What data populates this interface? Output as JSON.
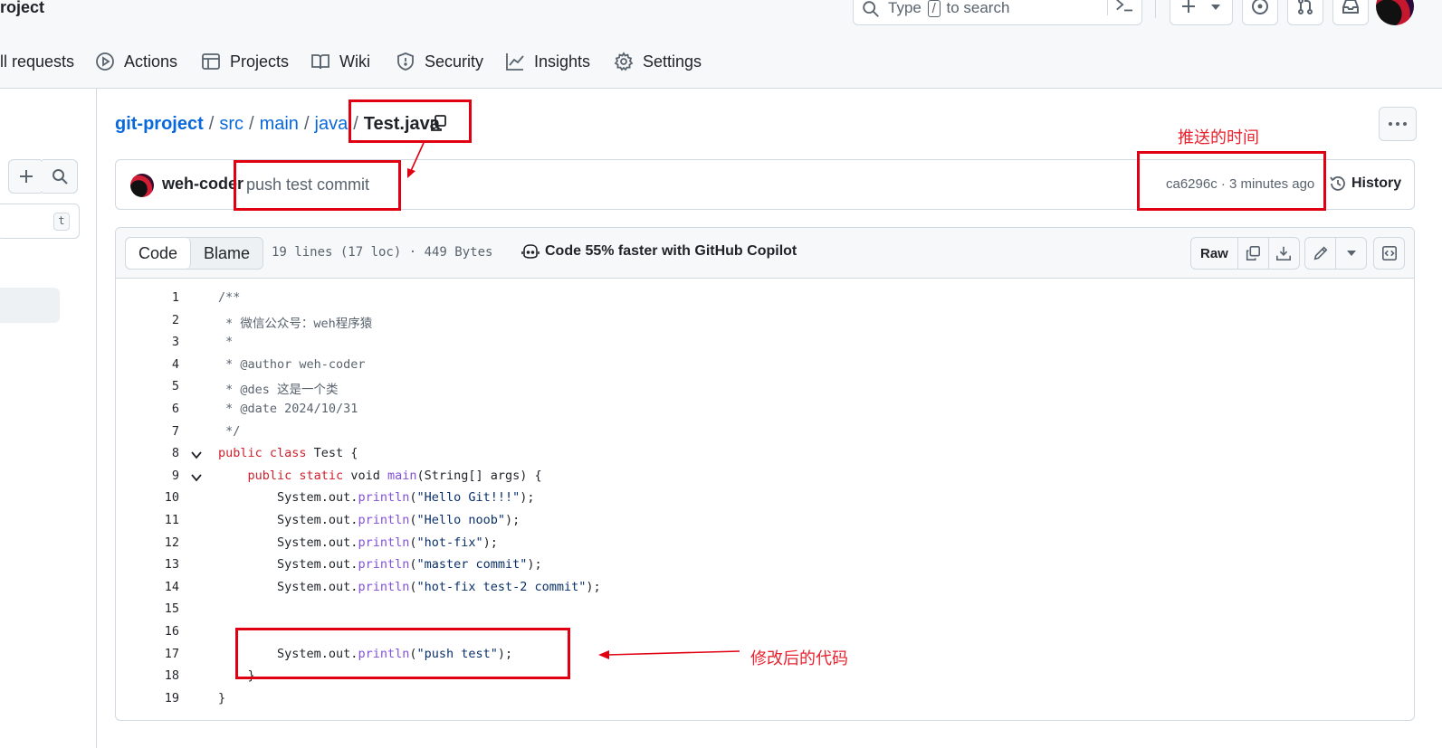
{
  "header": {
    "repo_name": "roject",
    "search_prefix": "Type",
    "search_key": "/",
    "search_suffix": "to search"
  },
  "tabs": [
    {
      "label": "ll requests",
      "icon": "pull-request-icon"
    },
    {
      "label": "Actions",
      "icon": "play-icon"
    },
    {
      "label": "Projects",
      "icon": "table-icon"
    },
    {
      "label": "Wiki",
      "icon": "book-icon"
    },
    {
      "label": "Security",
      "icon": "shield-icon"
    },
    {
      "label": "Insights",
      "icon": "graph-icon"
    },
    {
      "label": "Settings",
      "icon": "gear-icon"
    }
  ],
  "sidebar": {
    "shortcut_key": "t"
  },
  "breadcrumb": {
    "repo": "git-project",
    "parts": [
      "src",
      "main",
      "java"
    ],
    "file": "Test.java",
    "separator": "/"
  },
  "commit": {
    "author": "weh-coder",
    "message": "push test commit",
    "meta": "ca6296c · 3 minutes ago",
    "history_label": "History"
  },
  "file": {
    "tab_code": "Code",
    "tab_blame": "Blame",
    "stats": "19 lines (17 loc) · 449 Bytes",
    "copilot": "Code 55% faster with GitHub Copilot",
    "raw_label": "Raw"
  },
  "code_lines": [
    {
      "n": "1",
      "parts": [
        [
          "cm",
          "/**"
        ]
      ]
    },
    {
      "n": "2",
      "parts": [
        [
          "cm",
          " * 微信公众号：weh程序猿"
        ]
      ]
    },
    {
      "n": "3",
      "parts": [
        [
          "cm",
          " *"
        ]
      ]
    },
    {
      "n": "4",
      "parts": [
        [
          "cm",
          " * @author weh-coder"
        ]
      ]
    },
    {
      "n": "5",
      "parts": [
        [
          "cm",
          " * @des 这是一个类"
        ]
      ]
    },
    {
      "n": "6",
      "parts": [
        [
          "cm",
          " * @date 2024/10/31"
        ]
      ]
    },
    {
      "n": "7",
      "parts": [
        [
          "cm",
          " */"
        ]
      ]
    },
    {
      "n": "8",
      "fold": true,
      "parts": [
        [
          "kw",
          "public class "
        ],
        [
          "",
          "Test {"
        ]
      ]
    },
    {
      "n": "9",
      "fold": true,
      "parts": [
        [
          "",
          "    "
        ],
        [
          "kw",
          "public static "
        ],
        [
          "",
          "void "
        ],
        [
          "fn",
          "main"
        ],
        [
          "",
          "(String[] args) {"
        ]
      ]
    },
    {
      "n": "10",
      "parts": [
        [
          "",
          "        System.out."
        ],
        [
          "fn",
          "println"
        ],
        [
          "",
          "("
        ],
        [
          "st",
          "\"Hello Git!!!\""
        ],
        [
          "",
          ");"
        ]
      ]
    },
    {
      "n": "11",
      "parts": [
        [
          "",
          "        System.out."
        ],
        [
          "fn",
          "println"
        ],
        [
          "",
          "("
        ],
        [
          "st",
          "\"Hello noob\""
        ],
        [
          "",
          ");"
        ]
      ]
    },
    {
      "n": "12",
      "parts": [
        [
          "",
          "        System.out."
        ],
        [
          "fn",
          "println"
        ],
        [
          "",
          "("
        ],
        [
          "st",
          "\"hot-fix\""
        ],
        [
          "",
          ");"
        ]
      ]
    },
    {
      "n": "13",
      "parts": [
        [
          "",
          "        System.out."
        ],
        [
          "fn",
          "println"
        ],
        [
          "",
          "("
        ],
        [
          "st",
          "\"master commit\""
        ],
        [
          "",
          ");"
        ]
      ]
    },
    {
      "n": "14",
      "parts": [
        [
          "",
          "        System.out."
        ],
        [
          "fn",
          "println"
        ],
        [
          "",
          "("
        ],
        [
          "st",
          "\"hot-fix test-2 commit\""
        ],
        [
          "",
          ");"
        ]
      ]
    },
    {
      "n": "15",
      "parts": [
        [
          "",
          ""
        ]
      ]
    },
    {
      "n": "16",
      "parts": [
        [
          "",
          ""
        ]
      ]
    },
    {
      "n": "17",
      "parts": [
        [
          "",
          "        System.out."
        ],
        [
          "fn",
          "println"
        ],
        [
          "",
          "("
        ],
        [
          "st",
          "\"push test\""
        ],
        [
          "",
          ");"
        ]
      ]
    },
    {
      "n": "18",
      "parts": [
        [
          "",
          "    }"
        ]
      ]
    },
    {
      "n": "19",
      "parts": [
        [
          "",
          "}"
        ]
      ]
    }
  ],
  "annotations": {
    "push_time": "推送的时间",
    "modified_code": "修改后的代码"
  },
  "colors": {
    "link": "#0969da",
    "keyword": "#cf222e",
    "function": "#8250df",
    "string": "#0a3069",
    "annotation": "#e00012"
  }
}
